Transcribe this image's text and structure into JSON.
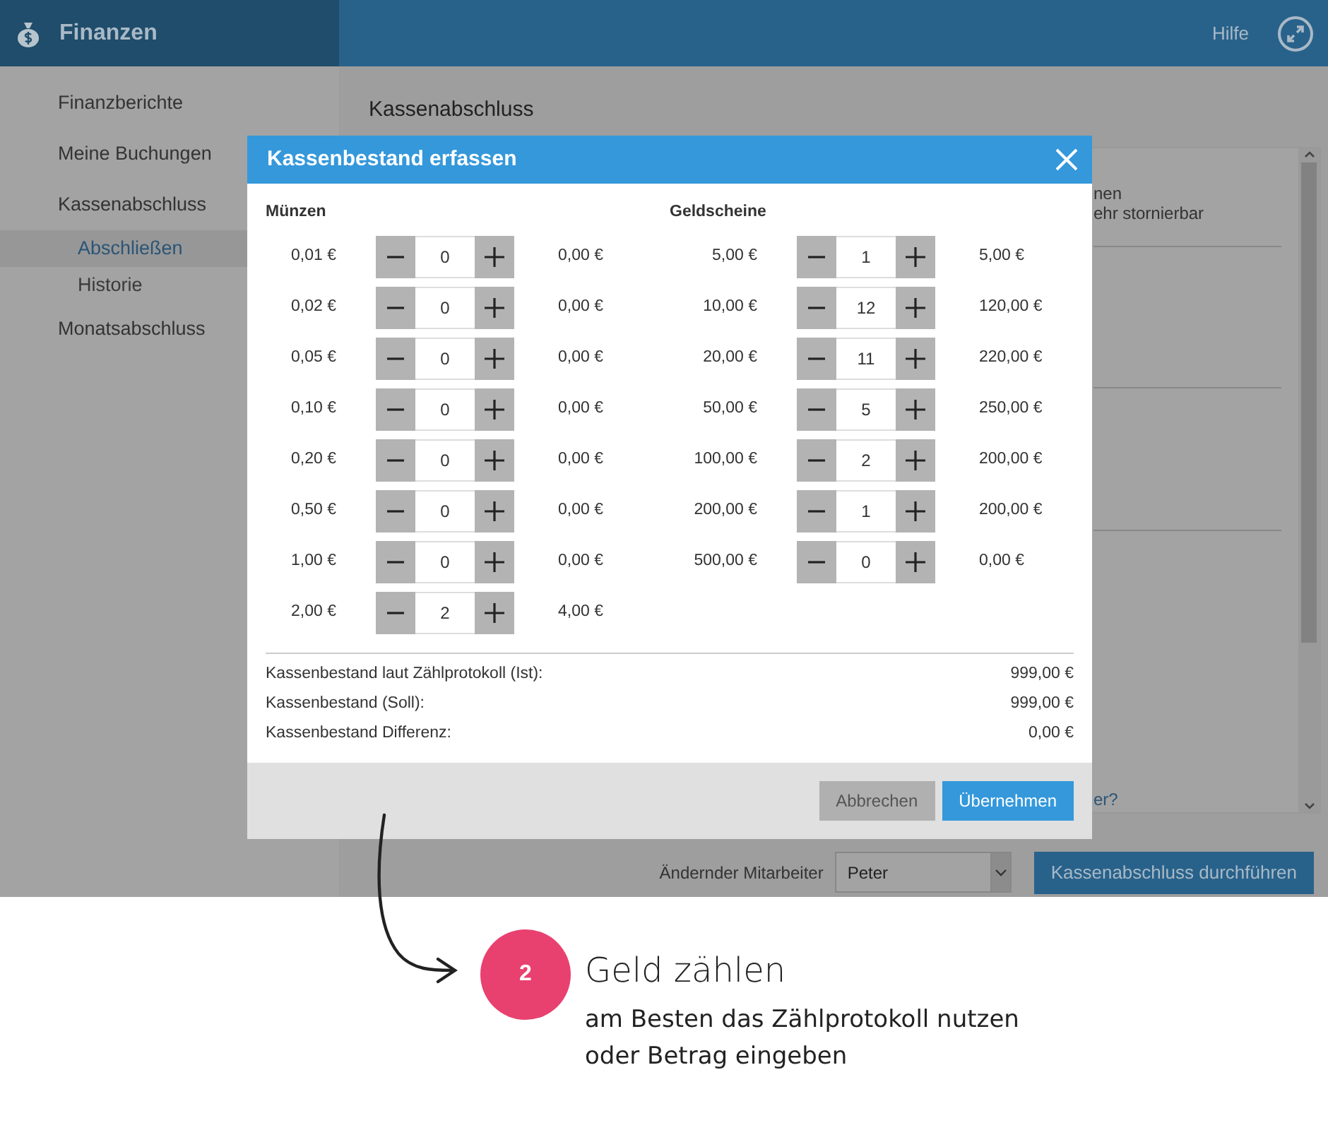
{
  "header": {
    "title": "Finanzen",
    "help": "Hilfe"
  },
  "sidebar": {
    "items": [
      {
        "label": "Finanzberichte",
        "selected": false
      },
      {
        "label": "Meine Buchungen",
        "selected": false
      },
      {
        "label": "Kassenabschluss",
        "selected": false,
        "children": [
          {
            "label": "Abschließen",
            "selected": true
          },
          {
            "label": "Historie",
            "selected": false
          }
        ]
      },
      {
        "label": "Monatsabschluss",
        "selected": false
      }
    ]
  },
  "page": {
    "title": "Kassenabschluss",
    "panel_fragments": [
      "nen",
      "ehr stornierbar"
    ],
    "link_fragment": "er?",
    "employee_label": "Ändernder Mitarbeiter",
    "employee": "Peter",
    "submit": "Kassenabschluss durchführen"
  },
  "modal": {
    "title": "Kassenbestand erfassen",
    "sections": [
      {
        "heading": "Münzen",
        "rows": [
          {
            "denomination": "0,01 €",
            "count": "0",
            "total": "0,00 €"
          },
          {
            "denomination": "0,02 €",
            "count": "0",
            "total": "0,00 €"
          },
          {
            "denomination": "0,05 €",
            "count": "0",
            "total": "0,00 €"
          },
          {
            "denomination": "0,10 €",
            "count": "0",
            "total": "0,00 €"
          },
          {
            "denomination": "0,20 €",
            "count": "0",
            "total": "0,00 €"
          },
          {
            "denomination": "0,50 €",
            "count": "0",
            "total": "0,00 €"
          },
          {
            "denomination": "1,00 €",
            "count": "0",
            "total": "0,00 €"
          },
          {
            "denomination": "2,00 €",
            "count": "2",
            "total": "4,00 €"
          }
        ]
      },
      {
        "heading": "Geldscheine",
        "rows": [
          {
            "denomination": "5,00 €",
            "count": "1",
            "total": "5,00 €"
          },
          {
            "denomination": "10,00 €",
            "count": "12",
            "total": "120,00 €"
          },
          {
            "denomination": "20,00 €",
            "count": "11",
            "total": "220,00 €"
          },
          {
            "denomination": "50,00 €",
            "count": "5",
            "total": "250,00 €"
          },
          {
            "denomination": "100,00 €",
            "count": "2",
            "total": "200,00 €"
          },
          {
            "denomination": "200,00 €",
            "count": "1",
            "total": "200,00 €"
          },
          {
            "denomination": "500,00 €",
            "count": "0",
            "total": "0,00 €"
          }
        ]
      }
    ],
    "summary": [
      {
        "label": "Kassenbestand laut Zählprotokoll (Ist):",
        "value": "999,00 €"
      },
      {
        "label": "Kassenbestand (Soll):",
        "value": "999,00 €"
      },
      {
        "label": "Kassenbestand Differenz:",
        "value": "0,00 €"
      }
    ],
    "buttons": [
      {
        "label": "Abbrechen",
        "kind": "secondary"
      },
      {
        "label": "Übernehmen",
        "kind": "primary"
      }
    ]
  },
  "annotation": {
    "step": "2",
    "title": "Geld zählen",
    "lines": [
      "am Besten das Zählprotokoll nutzen",
      "oder Betrag eingeben"
    ]
  }
}
